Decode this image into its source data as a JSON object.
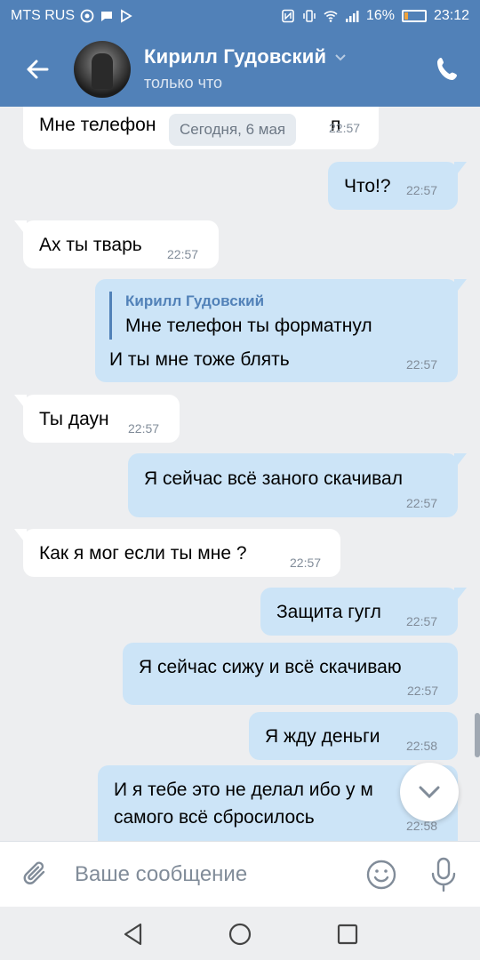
{
  "status_bar": {
    "carrier": "MTS RUS",
    "battery": "16%",
    "time": "23:12"
  },
  "header": {
    "contact_name": "Кирилл Гудовский",
    "contact_status": "только что"
  },
  "date_separator": "Сегодня, 6 мая",
  "messages": [
    {
      "direction": "in",
      "text": "Мне телефон",
      "time": "22:57",
      "cut_suffix": "п"
    },
    {
      "direction": "out",
      "text": "Что!?",
      "time": "22:57"
    },
    {
      "direction": "in",
      "text": "Ах ты тварь",
      "time": "22:57"
    },
    {
      "direction": "out",
      "reply_to": {
        "name": "Кирилл Гудовский",
        "text": "Мне телефон ты форматнул"
      },
      "text": "И ты мне тоже блять",
      "time": "22:57"
    },
    {
      "direction": "in",
      "text": "Ты даун",
      "time": "22:57"
    },
    {
      "direction": "out",
      "text": "Я сейчас всё заного скачивал",
      "time": "22:57"
    },
    {
      "direction": "in",
      "text": "Как я мог если ты мне ?",
      "time": "22:57"
    },
    {
      "direction": "out",
      "text": "Защита гугл",
      "time": "22:57"
    },
    {
      "direction": "out",
      "text": "Я сейчас сижу и всё скачиваю",
      "time": "22:57"
    },
    {
      "direction": "out",
      "text": "Я жду деньги",
      "time": "22:58"
    },
    {
      "direction": "out",
      "text_line1": "И я тебе это не делал ибо у м",
      "text_line2": "самого всё сбросилось",
      "time": "22:58"
    }
  ],
  "composer": {
    "placeholder": "Ваше сообщение"
  },
  "icons": {
    "back": "arrow-left-icon",
    "call": "phone-icon",
    "attach": "paperclip-icon",
    "emoji": "smiley-icon",
    "mic": "microphone-icon",
    "scroll_down": "chevron-down-icon"
  },
  "colors": {
    "accent": "#5181b8",
    "incoming_bubble": "#ffffff",
    "outgoing_bubble": "#cce4f7",
    "background": "#edeef0",
    "time_text": "#818c99"
  }
}
